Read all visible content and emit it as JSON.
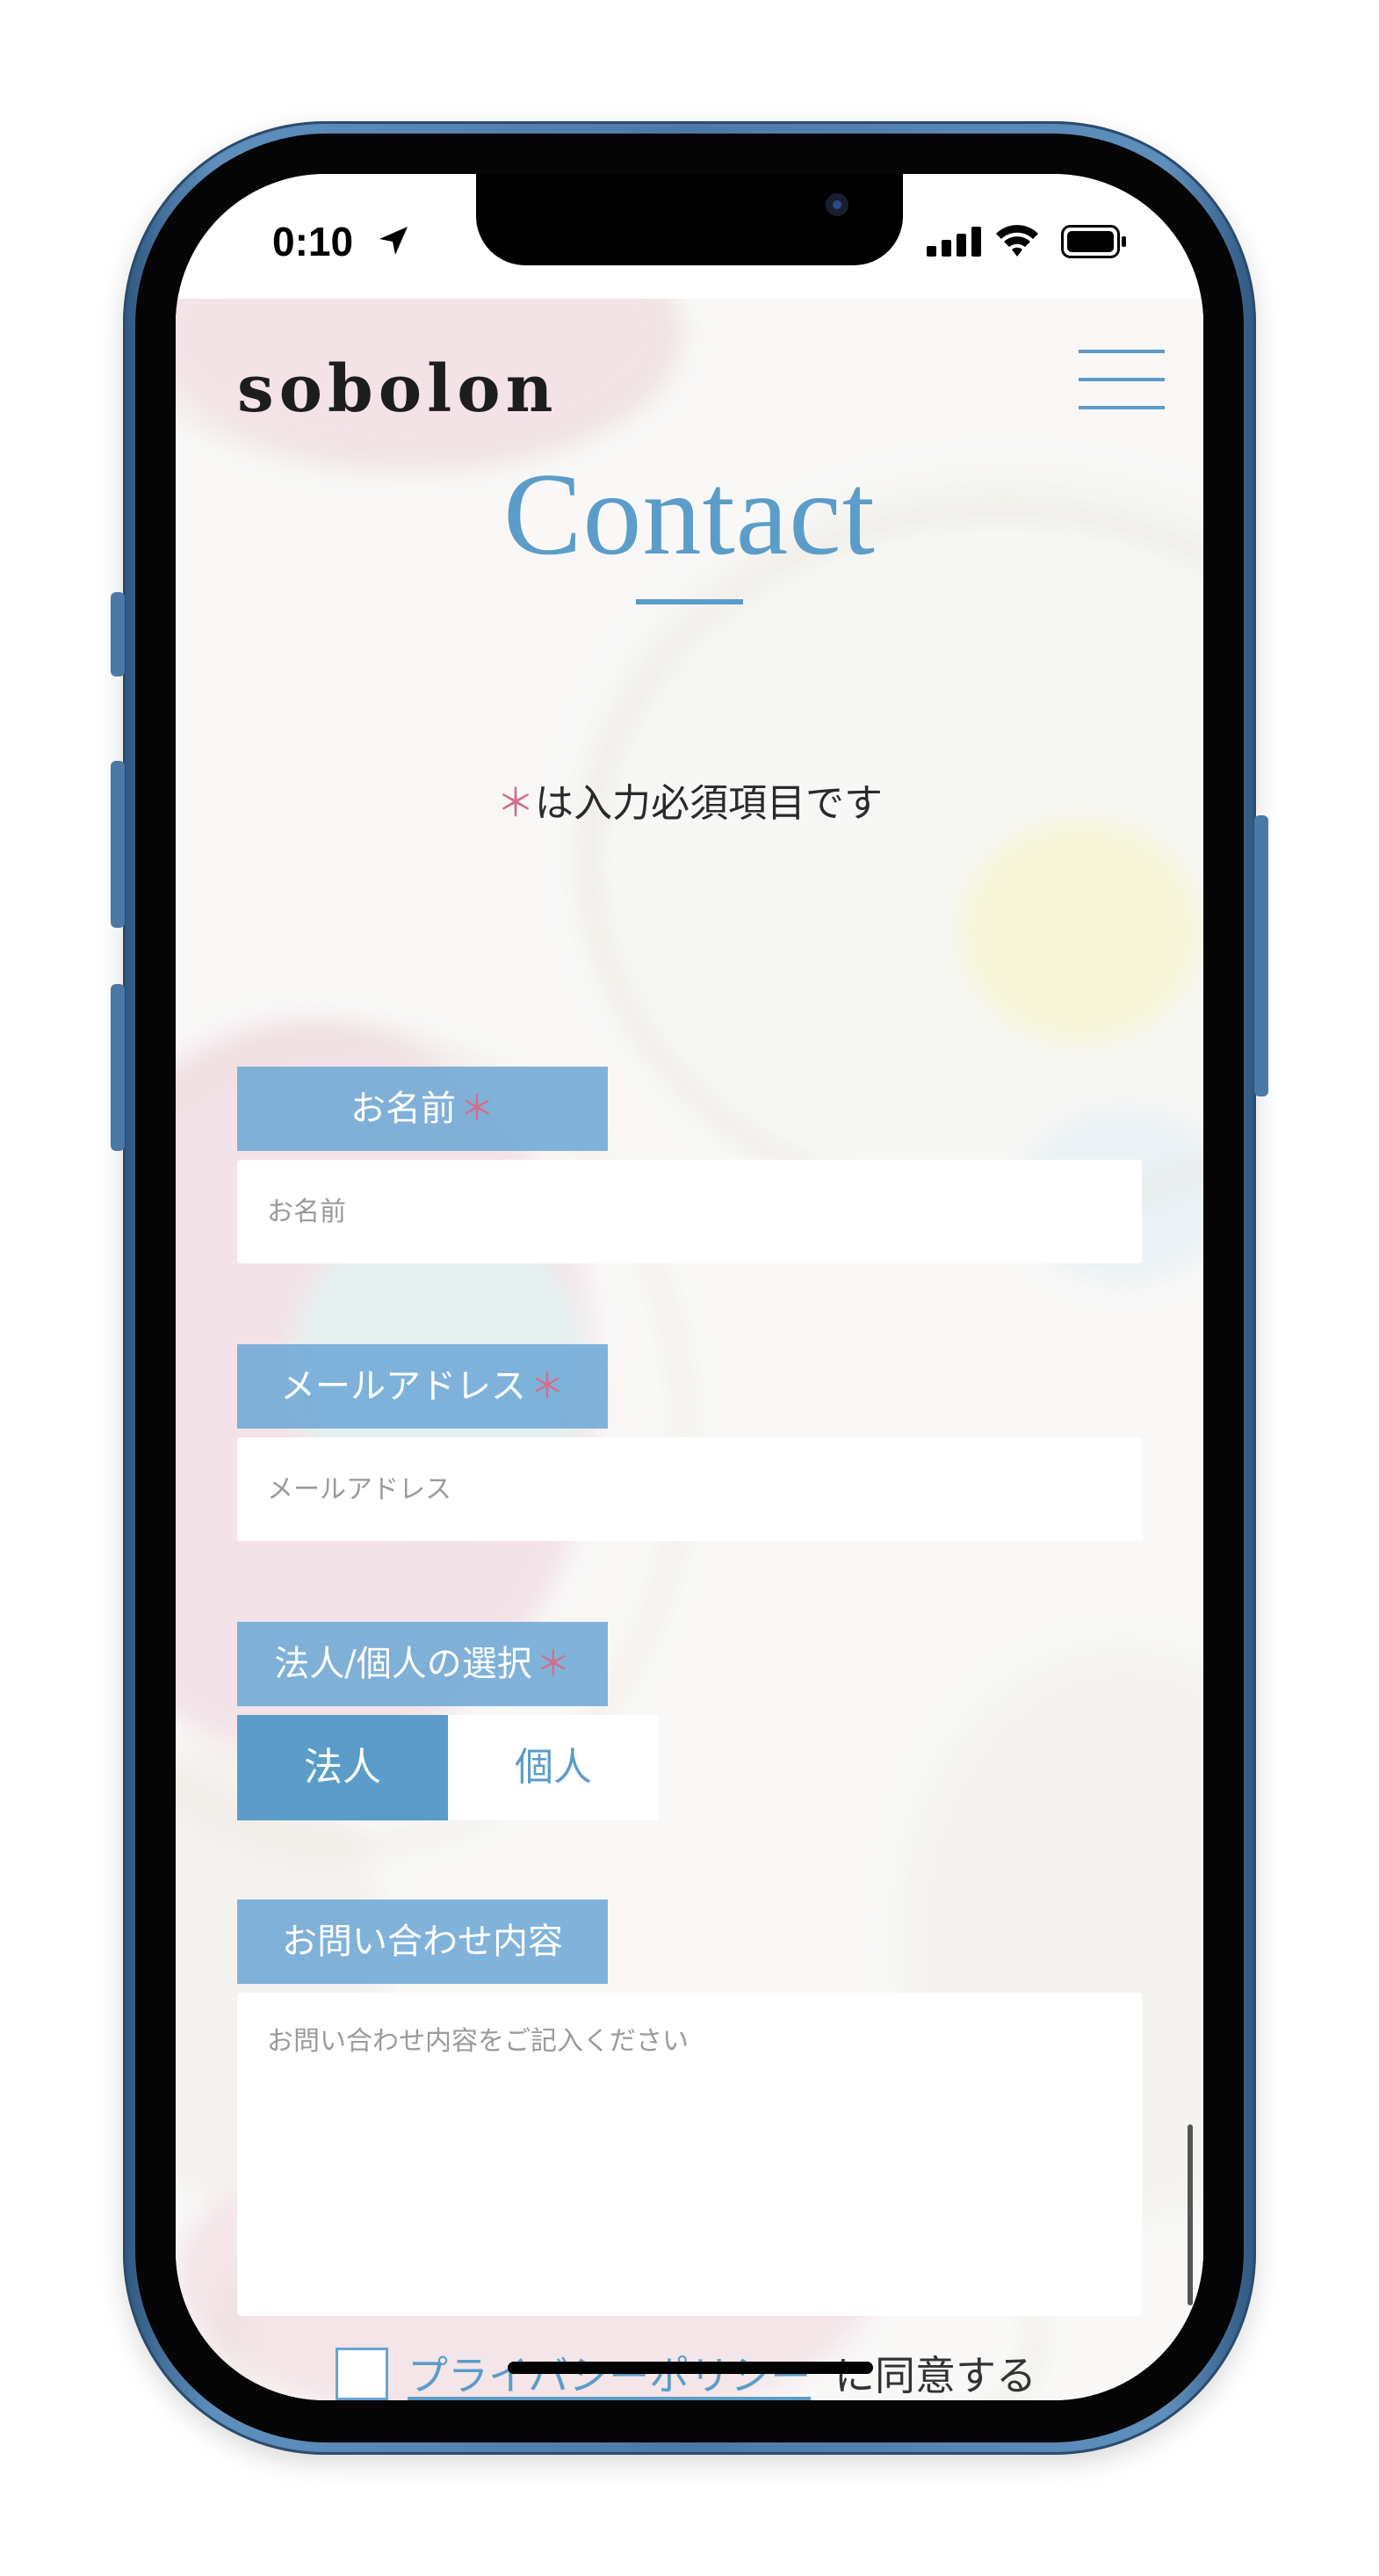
{
  "status_bar": {
    "time": "0:10",
    "location_icon": "location-arrow-icon",
    "signal_icon": "cellular-signal-icon",
    "wifi_icon": "wifi-icon",
    "battery_icon": "battery-icon"
  },
  "header": {
    "logo": "sobolon",
    "menu_icon": "hamburger-menu-icon"
  },
  "main": {
    "title": "Contact",
    "required_note": {
      "asterisk": "＊",
      "text": "は入力必須項目です"
    }
  },
  "form": {
    "name": {
      "label": "お名前",
      "required_mark": "＊",
      "placeholder": "お名前",
      "value": ""
    },
    "email": {
      "label": "メールアドレス",
      "required_mark": "＊",
      "placeholder": "メールアドレス",
      "value": ""
    },
    "type": {
      "label": "法人/個人の選択",
      "required_mark": "＊",
      "options": [
        "法人",
        "個人"
      ],
      "selected": "法人"
    },
    "message": {
      "label": "お問い合わせ内容",
      "placeholder": "お問い合わせ内容をご記入ください",
      "value": ""
    },
    "consent": {
      "checked": false,
      "link_text": "プライバシーポリシー",
      "text": "に同意する"
    }
  },
  "colors": {
    "accent": "#5b9dc8",
    "label_bg": "#6fa8d6",
    "required": "#d36e8a",
    "phone_frame": "#4b79a8"
  }
}
